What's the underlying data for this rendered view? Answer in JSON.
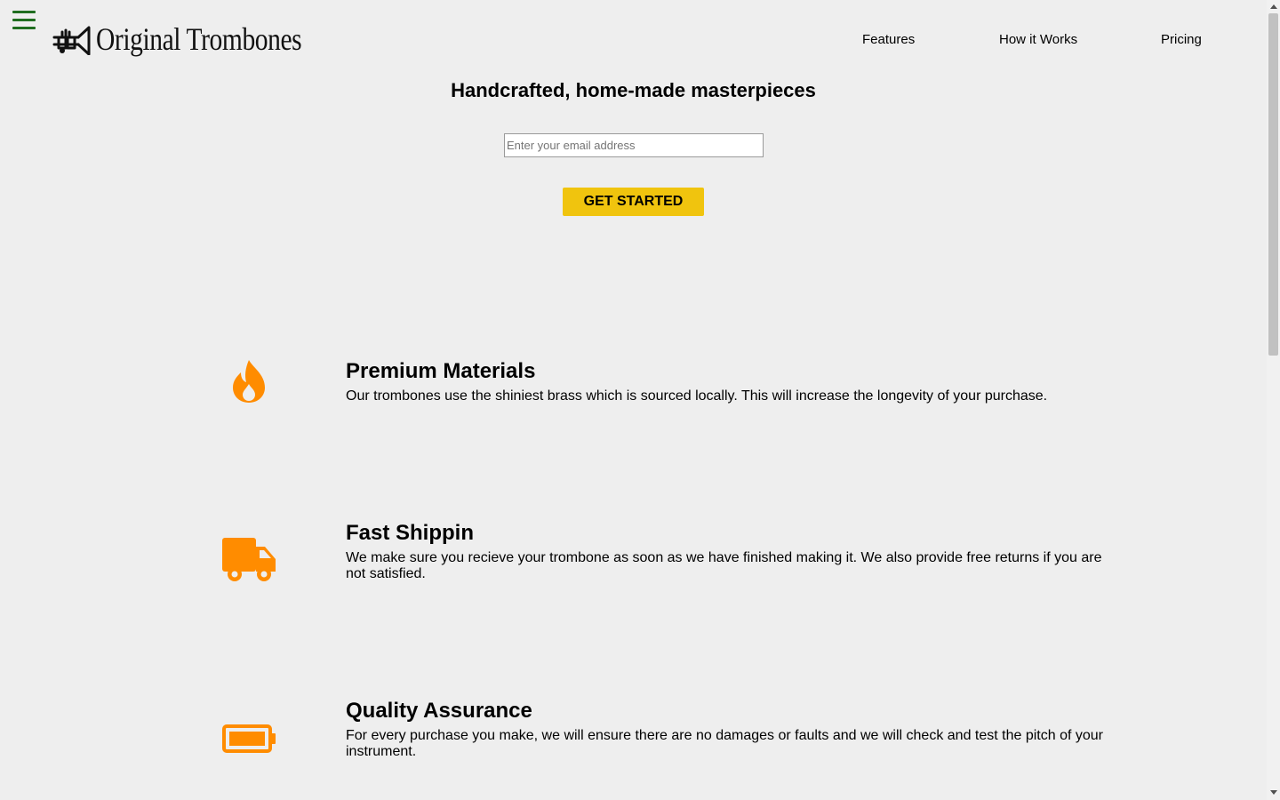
{
  "header": {
    "logo_text": "Original Trombones",
    "nav": [
      {
        "label": "Features"
      },
      {
        "label": "How it Works"
      },
      {
        "label": "Pricing"
      }
    ]
  },
  "hero": {
    "title": "Handcrafted, home-made masterpieces",
    "email_placeholder": "Enter your email address",
    "email_value": "",
    "cta_label": "GET STARTED"
  },
  "features": [
    {
      "icon": "fire-icon",
      "title": "Premium Materials",
      "description": "Our trombones use the shiniest brass which is sourced locally. This will increase the longevity of your purchase."
    },
    {
      "icon": "truck-icon",
      "title": "Fast Shippin",
      "description": "We make sure you recieve your trombone as soon as we have finished making it. We also provide free returns if you are not satisfied."
    },
    {
      "icon": "battery-icon",
      "title": "Quality Assurance",
      "description": "For every purchase you make, we will ensure there are no damages or faults and we will check and test the pitch of your instrument."
    }
  ],
  "colors": {
    "background": "#eeeeee",
    "hamburger": "#1f6d1f",
    "cta": "#f0c40e",
    "icon_accent": "#ff8c00"
  }
}
